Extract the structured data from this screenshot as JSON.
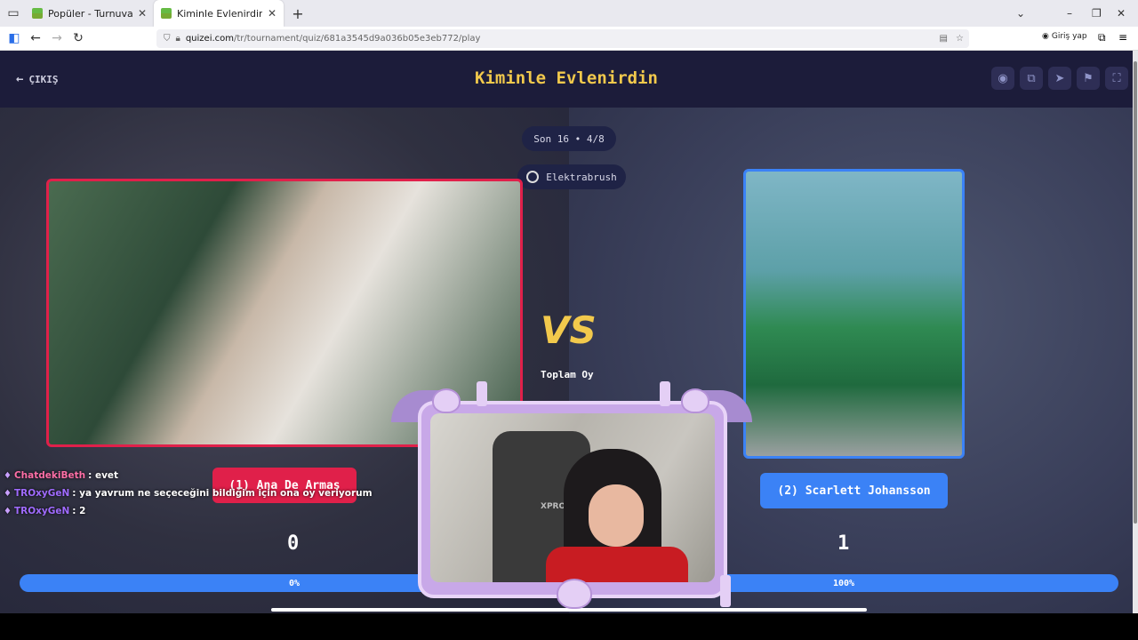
{
  "browser": {
    "tabs": [
      {
        "title": "Popüler - Turnuva - Quizei",
        "active": false
      },
      {
        "title": "Kiminle Evlenirdin - Tier List, Kı",
        "active": true
      }
    ],
    "new_tab": "+",
    "url_domain": "quizei.com",
    "url_path": "/tr/tournament/quiz/681a3545d9a036b05e3eb772/play",
    "login_label": "Giriş yap"
  },
  "header": {
    "exit_label": "ÇIKIŞ",
    "title": "Kiminle Evlenirdin",
    "icons": [
      "eye-icon",
      "share-icon",
      "send-icon",
      "flag-icon",
      "fullscreen-icon"
    ]
  },
  "round": {
    "progress_label": "Son 16 • 4/8",
    "author": "Elektrabrush"
  },
  "matchup": {
    "left": {
      "label": "(1) Ana De Armas",
      "votes": "0",
      "percent_label": "0%",
      "percent": 0,
      "color": "#e0204a"
    },
    "right": {
      "label": "(2) Scarlett Johansson",
      "votes": "1",
      "percent_label": "100%",
      "percent": 100,
      "color": "#3b82f6"
    },
    "vs_label": "VS",
    "total_votes_label": "Toplam Oy"
  },
  "chat": [
    {
      "user": "ChatdekiBeth",
      "message": ": evet"
    },
    {
      "user": "TROxyGeN",
      "message": ": ya yavrum ne seçeceğini bildiğim için ona oy veriyorum"
    },
    {
      "user": "TROxyGeN",
      "message": ": 2"
    }
  ],
  "webcam": {
    "chair_brand": "XPRO"
  }
}
